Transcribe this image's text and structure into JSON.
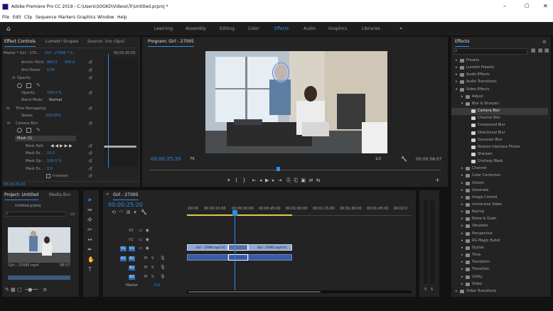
{
  "window": {
    "title": "Adobe Premiere Pro CC 2019 - C:\\Users\\SOGKO\\Videos\\Tr\\Untitled.prproj *"
  },
  "menu": [
    "File",
    "Edit",
    "Clip",
    "Sequence",
    "Markers",
    "Graphics",
    "Window",
    "Help"
  ],
  "workspaces": [
    "Learning",
    "Assembly",
    "Editing",
    "Color",
    "Effects",
    "Audio",
    "Graphics",
    "Libraries"
  ],
  "workspace_active": "Effects",
  "source_panel": {
    "tabs": [
      "Effect Controls",
      "Lumetri Scopes",
      "Source: (no clips)"
    ],
    "clip_path": "Master * Girl - 270...",
    "sequence": "Girl - 27095 * G...",
    "timecode": "00:00:30:00",
    "rows": [
      {
        "label": "Anchor Point",
        "v1": "960.0",
        "v2": "540.0"
      },
      {
        "label": "Anti-flicker",
        "v1": "0.00"
      },
      {
        "label": "Opacity"
      },
      {
        "label": "Opacity",
        "v1": "100.0 %"
      },
      {
        "label": "Blend Mode",
        "v1": "Normal"
      },
      {
        "label": "Time Remapping"
      },
      {
        "label": "Speed",
        "v1": "100.00%"
      },
      {
        "label": "Camera Blur"
      },
      {
        "label": "Mask (1)"
      },
      {
        "label": "Mask Path"
      },
      {
        "label": "Mask Fe...",
        "v1": "10.0"
      },
      {
        "label": "Mask Op...",
        "v1": "100.0 %"
      },
      {
        "label": "Mask Ex...",
        "v1": "0.0"
      },
      {
        "label": "Inverted"
      }
    ],
    "fx": "fx",
    "current_time": "00:00:25:20"
  },
  "program": {
    "title": "Program: Girl - 27095",
    "timecode": "00:00:25:20",
    "fit": "Fit",
    "ratio": "1/2",
    "duration": "00:00:58:07"
  },
  "project": {
    "tabs": [
      "Project: Untitled",
      "Media Bro"
    ],
    "file": "Untitled.prproj",
    "clip_name": "Girl - 27095.mp4",
    "clip_duration": "58:07"
  },
  "timeline": {
    "title": "Girl - 27095",
    "timecode": "00:00:25:20",
    "ruler": [
      ":00:00",
      "00:00:15:00",
      "00:00:30:00",
      "00:00:45:00",
      "00:01:00:00",
      "00:01:15:00",
      "00:01:30:00",
      "00:01:45:00",
      "00:02:0"
    ],
    "tracks_video": [
      "V3",
      "V2",
      "V1"
    ],
    "tracks_audio": [
      "A1",
      "A2",
      "A3"
    ],
    "track_toggles": {
      "V1": "V1",
      "A1": "A1"
    },
    "audio_extra": [
      "M",
      "S"
    ],
    "master": "Master",
    "master_val": "0.0",
    "clip_label": "Girl - 27095.mp4 [V]",
    "meter_labels": [
      "S",
      "S"
    ]
  },
  "effects": {
    "title": "Effects",
    "items": [
      {
        "label": "Presets",
        "type": "folder",
        "level": 0,
        "open": false
      },
      {
        "label": "Lumetri Presets",
        "type": "folder",
        "level": 0,
        "open": false
      },
      {
        "label": "Audio Effects",
        "type": "folder",
        "level": 0,
        "open": false
      },
      {
        "label": "Audio Transitions",
        "type": "folder",
        "level": 0,
        "open": false
      },
      {
        "label": "Video Effects",
        "type": "folder",
        "level": 0,
        "open": true
      },
      {
        "label": "Adjust",
        "type": "folder",
        "level": 1,
        "open": false
      },
      {
        "label": "Blur & Sharpen",
        "type": "folder",
        "level": 1,
        "open": true
      },
      {
        "label": "Camera Blur",
        "type": "effect",
        "level": 2,
        "selected": true
      },
      {
        "label": "Channel Blur",
        "type": "effect",
        "level": 2
      },
      {
        "label": "Compound Blur",
        "type": "effect",
        "level": 2
      },
      {
        "label": "Directional Blur",
        "type": "effect",
        "level": 2
      },
      {
        "label": "Gaussian Blur",
        "type": "effect",
        "level": 2
      },
      {
        "label": "Reduce Interlace Flicker",
        "type": "effect",
        "level": 2
      },
      {
        "label": "Sharpen",
        "type": "effect",
        "level": 2
      },
      {
        "label": "Unsharp Mask",
        "type": "effect",
        "level": 2
      },
      {
        "label": "Channel",
        "type": "folder",
        "level": 1
      },
      {
        "label": "Color Correction",
        "type": "folder",
        "level": 1
      },
      {
        "label": "Distort",
        "type": "folder",
        "level": 1
      },
      {
        "label": "Generate",
        "type": "folder",
        "level": 1
      },
      {
        "label": "Image Control",
        "type": "folder",
        "level": 1
      },
      {
        "label": "Immersive Video",
        "type": "folder",
        "level": 1
      },
      {
        "label": "Keying",
        "type": "folder",
        "level": 1
      },
      {
        "label": "Noise & Grain",
        "type": "folder",
        "level": 1
      },
      {
        "label": "Obsolete",
        "type": "folder",
        "level": 1
      },
      {
        "label": "Perspective",
        "type": "folder",
        "level": 1
      },
      {
        "label": "RG Magic Bullet",
        "type": "folder",
        "level": 1
      },
      {
        "label": "Stylize",
        "type": "folder",
        "level": 1
      },
      {
        "label": "Time",
        "type": "folder",
        "level": 1
      },
      {
        "label": "Transform",
        "type": "folder",
        "level": 1
      },
      {
        "label": "Transition",
        "type": "folder",
        "level": 1
      },
      {
        "label": "Utility",
        "type": "folder",
        "level": 1
      },
      {
        "label": "Video",
        "type": "folder",
        "level": 1
      },
      {
        "label": "Video Transitions",
        "type": "folder",
        "level": 0
      }
    ]
  },
  "colors": {
    "accent": "#2d8ceb",
    "clip_video": "#8aa7d6",
    "clip_audio": "#3b5aa6",
    "playhead": "#2d8ceb"
  }
}
